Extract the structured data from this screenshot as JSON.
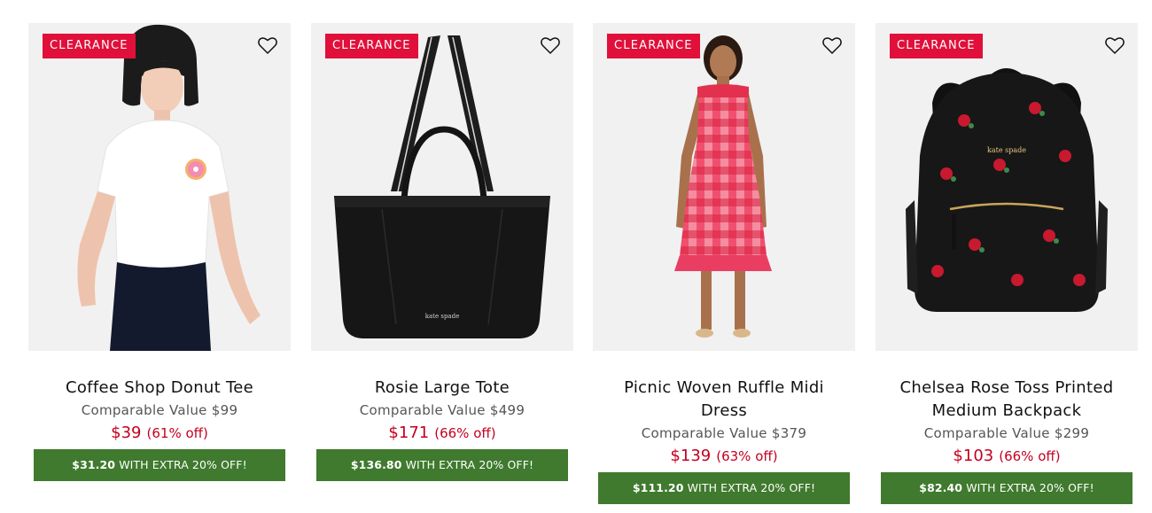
{
  "colors": {
    "clearance_badge": "#e0103a",
    "sale_price": "#c4001f",
    "extra_discount_bar": "#3f7a2e",
    "image_background": "#f1f1f1"
  },
  "products": [
    {
      "badge": "CLEARANCE",
      "name": "Coffee Shop Donut Tee",
      "comparable": "Comparable Value $99",
      "price": "$39",
      "discount": "(61% off)",
      "extra_price": "$31.20",
      "extra_text": "WITH EXTRA 20% OFF!",
      "wishlist_icon": "heart-outline-icon"
    },
    {
      "badge": "CLEARANCE",
      "name": "Rosie Large Tote",
      "comparable": "Comparable Value $499",
      "price": "$171",
      "discount": "(66% off)",
      "extra_price": "$136.80",
      "extra_text": "WITH EXTRA 20% OFF!",
      "wishlist_icon": "heart-outline-icon"
    },
    {
      "badge": "CLEARANCE",
      "name": "Picnic Woven Ruffle Midi Dress",
      "comparable": "Comparable Value $379",
      "price": "$139",
      "discount": "(63% off)",
      "extra_price": "$111.20",
      "extra_text": "WITH EXTRA 20% OFF!",
      "wishlist_icon": "heart-outline-icon"
    },
    {
      "badge": "CLEARANCE",
      "name": "Chelsea Rose Toss Printed Medium Backpack",
      "comparable": "Comparable Value $299",
      "price": "$103",
      "discount": "(66% off)",
      "extra_price": "$82.40",
      "extra_text": "WITH EXTRA 20% OFF!",
      "wishlist_icon": "heart-outline-icon"
    }
  ]
}
